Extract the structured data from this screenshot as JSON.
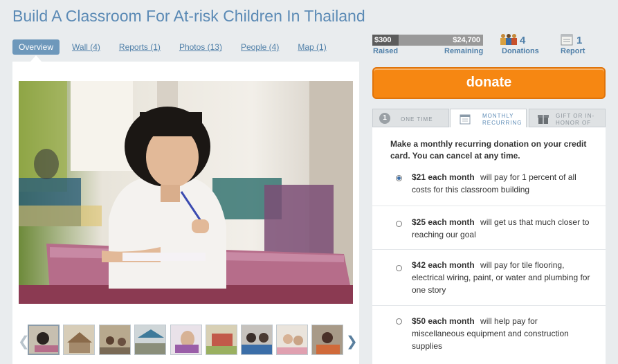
{
  "project": {
    "title": "Build A Classroom For At-risk Children In Thailand"
  },
  "tabs": [
    {
      "label": "Overview",
      "active": true
    },
    {
      "label": "Wall (4)"
    },
    {
      "label": "Reports (1)"
    },
    {
      "label": "Photos (13)"
    },
    {
      "label": "People (4)"
    },
    {
      "label": "Map (1)"
    }
  ],
  "stats": {
    "raised": "$300",
    "raised_label": "Raised",
    "remaining": "$24,700",
    "remaining_label": "Remaining",
    "progress_fraction": 0.012,
    "donations_count": "4",
    "donations_label": "Donations",
    "reports_count": "1",
    "reports_label": "Report"
  },
  "donate": {
    "label": "donate"
  },
  "donation_tabs": [
    {
      "number": "1",
      "label": "One time"
    },
    {
      "label": "Monthly recurring",
      "active": true
    },
    {
      "label": "Gift or in-honor of"
    }
  ],
  "donation_panel": {
    "heading": "Make a monthly recurring donation on your credit card. You can cancel at any time.",
    "options": [
      {
        "amount": "$21 each month",
        "desc": "will pay for 1 percent of all costs for this classroom building",
        "selected": true
      },
      {
        "amount": "$25 each month",
        "desc": "will get us that much closer to reaching our goal",
        "selected": false
      },
      {
        "amount": "$42 each month",
        "desc": "will pay for tile flooring, electrical wiring, paint, or water and plumbing for one story",
        "selected": false
      },
      {
        "amount": "$50 each month",
        "desc": "will help pay for miscellaneous equipment and construction supplies",
        "selected": false
      }
    ]
  },
  "colors": {
    "title_blue": "#5b8ab5",
    "link_blue": "#4f7fa8",
    "active_tab": "#6e98bb",
    "donate_orange": "#f68712",
    "progress_dark": "#5c5c5c"
  },
  "icons": [
    "people-icon",
    "report-icon",
    "gift-icon",
    "calendar-icon",
    "chevron-left-icon",
    "chevron-right-icon"
  ]
}
